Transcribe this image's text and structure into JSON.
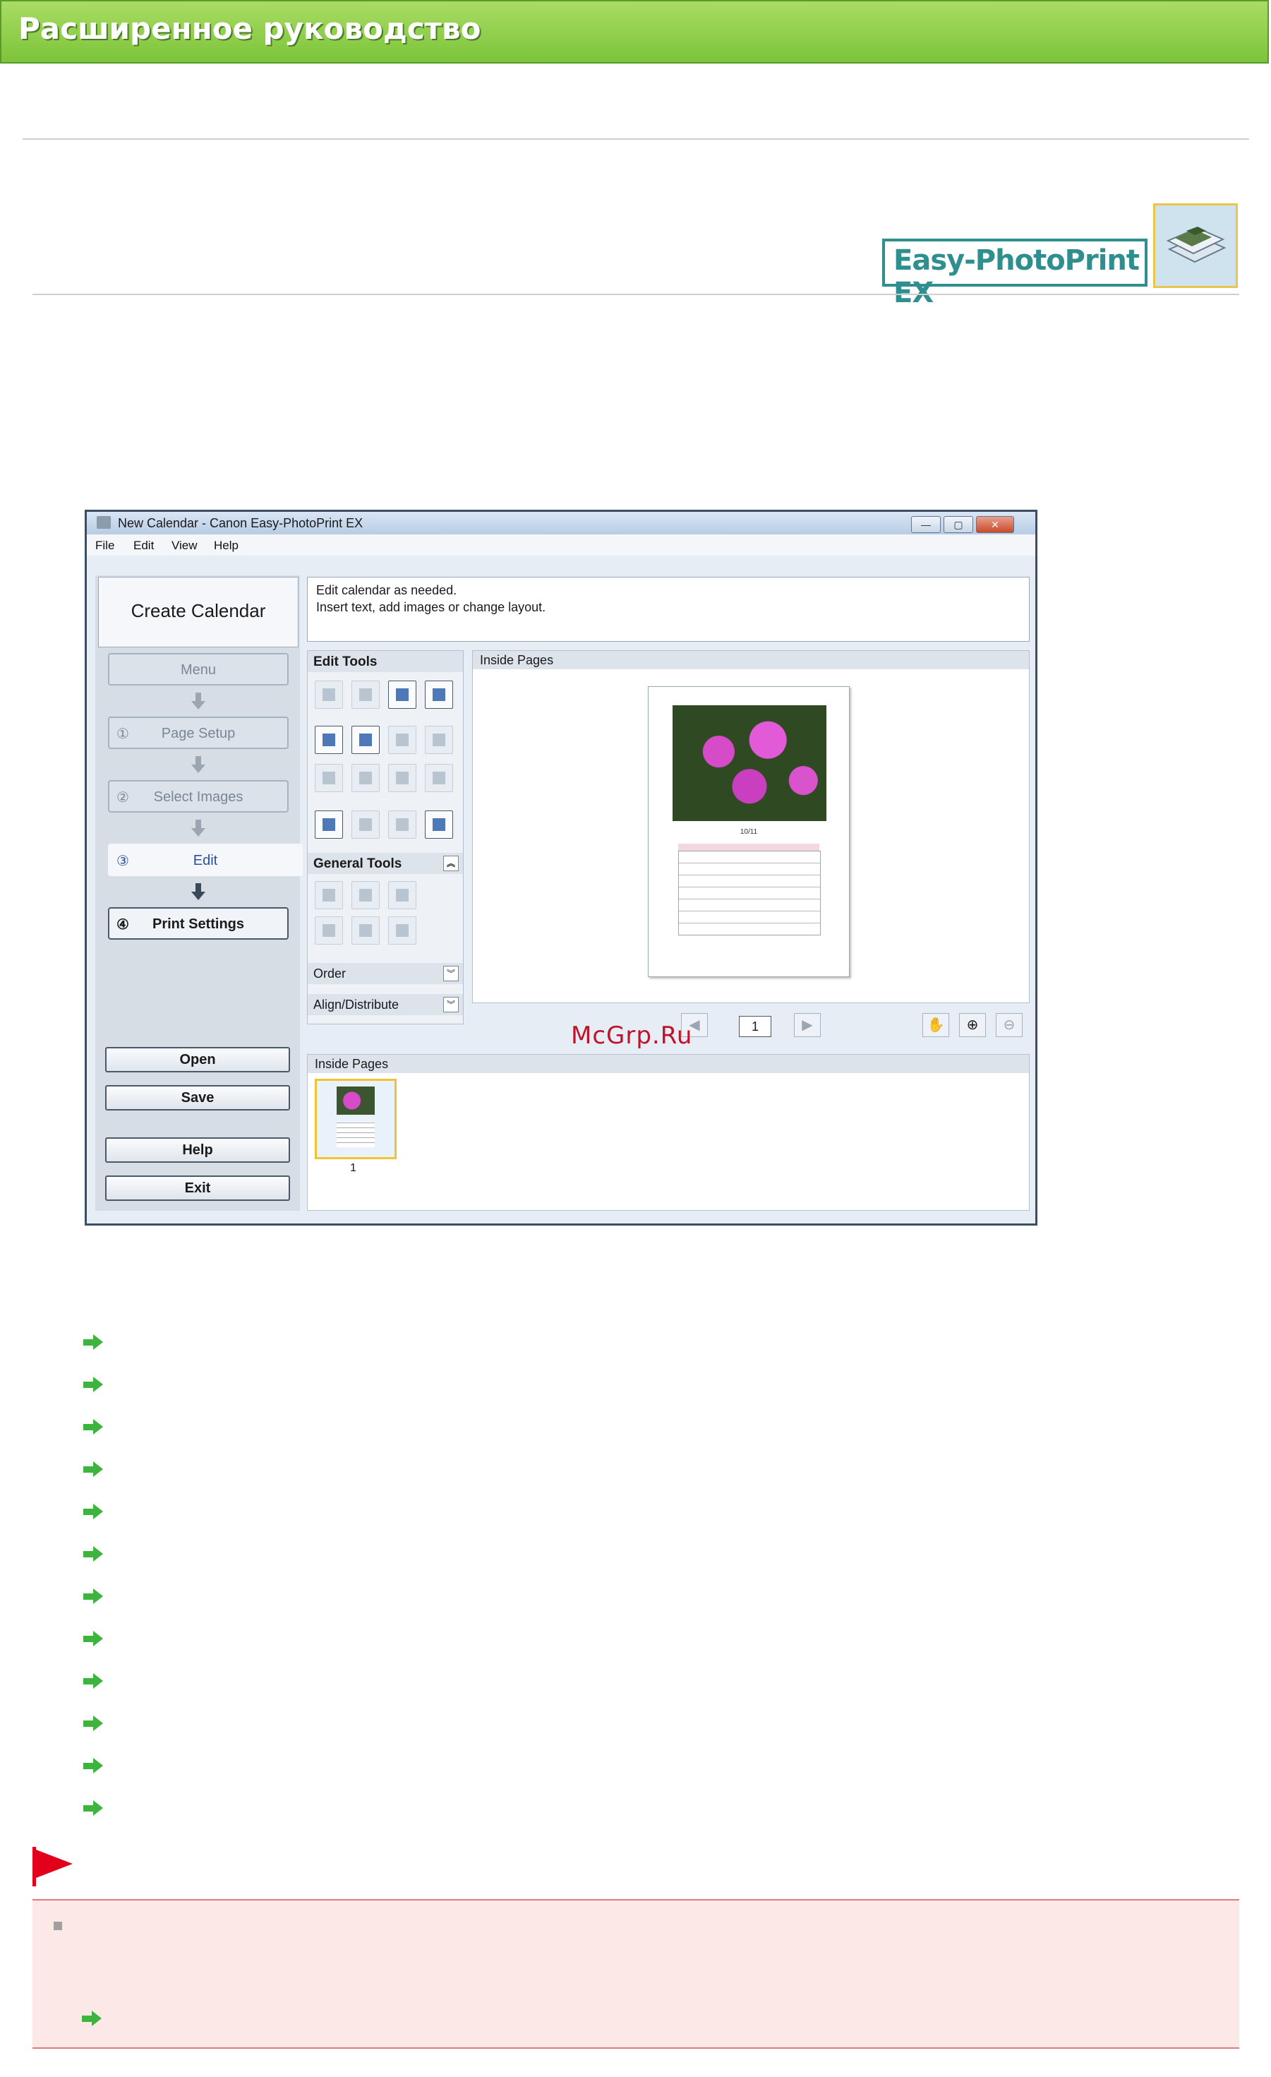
{
  "header": {
    "title": "Расширенное руководство"
  },
  "logo": {
    "text": "Easy-PhotoPrint EX"
  },
  "watermark": "McGrp.Ru",
  "app": {
    "window_title": "New Calendar - Canon Easy-PhotoPrint EX",
    "window_buttons": {
      "minimize": "—",
      "maximize": "▢",
      "close": "✕"
    },
    "menu": [
      "File",
      "Edit",
      "View",
      "Help"
    ],
    "create_title": "Create Calendar",
    "steps": [
      {
        "num": "",
        "label": "Menu"
      },
      {
        "num": "①",
        "label": "Page Setup"
      },
      {
        "num": "②",
        "label": "Select Images"
      },
      {
        "num": "③",
        "label": "Edit"
      },
      {
        "num": "④",
        "label": "Print Settings"
      }
    ],
    "buttons": {
      "open": "Open",
      "save": "Save",
      "help": "Help",
      "exit": "Exit"
    },
    "info": {
      "line1": "Edit calendar as needed.",
      "line2": "Insert text, add images or change layout."
    },
    "tools": {
      "edit_tools": "Edit Tools",
      "general_tools": "General Tools",
      "order": "Order",
      "align": "Align/Distribute",
      "chevron_up": "︽",
      "chevron_down": "︾"
    },
    "preview": {
      "header": "Inside Pages",
      "page_number": "1",
      "calendar_month": "10/11",
      "prev": "◀",
      "next": "▶",
      "hand": "✋",
      "zoom_in": "⊕",
      "zoom_out": "⊖"
    },
    "thumbnails": {
      "header": "Inside Pages",
      "page_label": "1"
    }
  },
  "colors": {
    "header_green": "#7cc43a",
    "link_arrow": "#3db43d",
    "flag_red": "#e2001a",
    "note_bg": "#fde8e8"
  },
  "link_arrows": 12
}
